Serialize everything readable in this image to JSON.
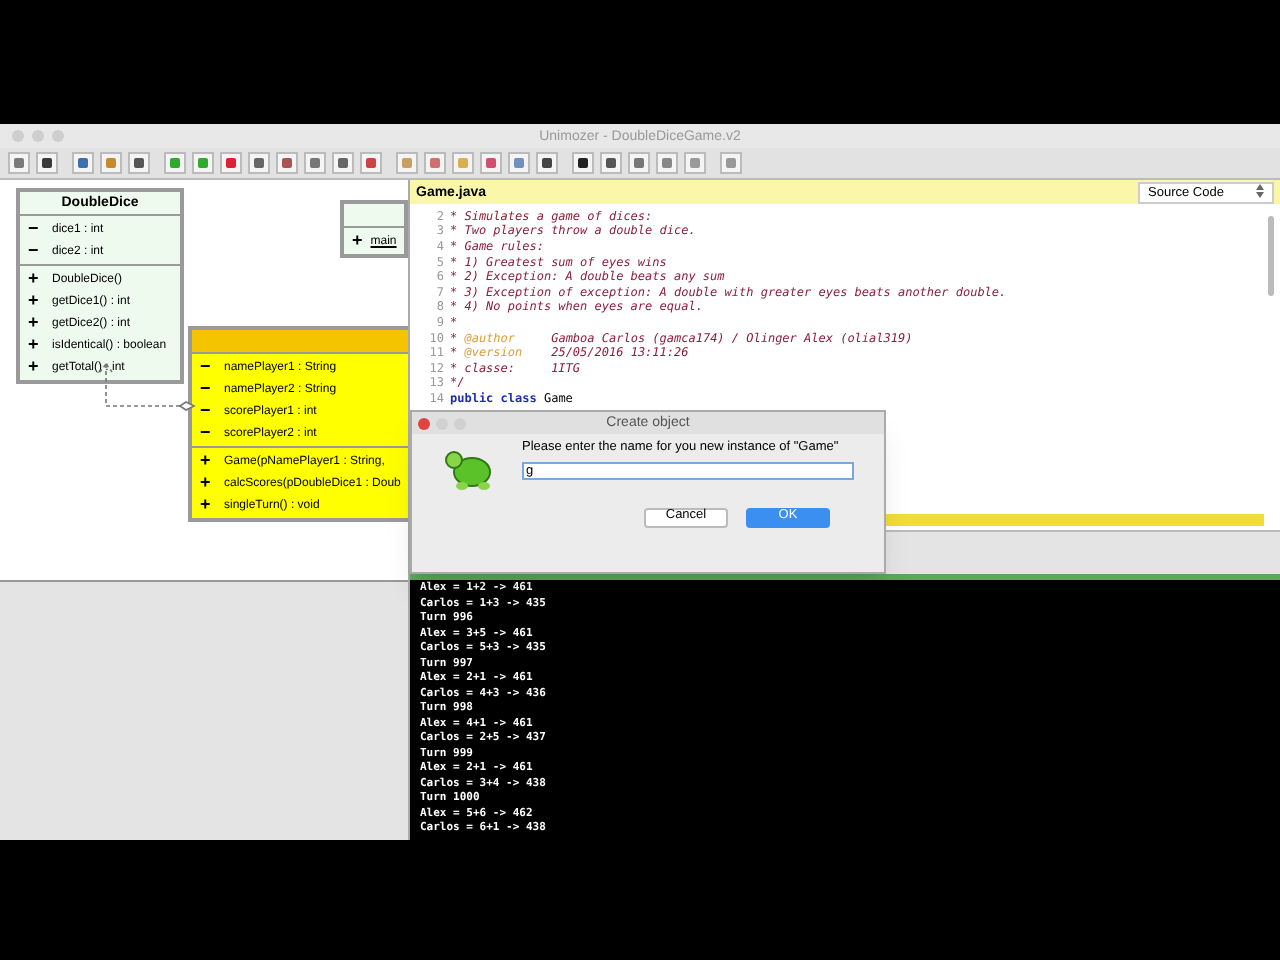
{
  "window": {
    "title": "Unimozer - DoubleDiceGame.v2"
  },
  "diagram": {
    "classes": [
      {
        "name": "DoubleDice",
        "selected": false,
        "members": [
          {
            "sign": "−",
            "text": "dice1 : int",
            "kind": "field"
          },
          {
            "sign": "−",
            "text": "dice2 : int",
            "kind": "field"
          },
          {
            "sign": "+",
            "text": "DoubleDice()",
            "kind": "method"
          },
          {
            "sign": "+",
            "text": "getDice1() : int",
            "kind": "method"
          },
          {
            "sign": "+",
            "text": "getDice2() : int",
            "kind": "method"
          },
          {
            "sign": "+",
            "text": "isIdentical() : boolean",
            "kind": "method"
          },
          {
            "sign": "+",
            "text": "getTotal() : int",
            "kind": "method"
          }
        ]
      },
      {
        "selected": false,
        "members": [
          {
            "sign": "+",
            "text": "main",
            "kind": "static"
          }
        ]
      },
      {
        "selected": true,
        "members": [
          {
            "sign": "−",
            "text": "namePlayer1 : String",
            "kind": "field"
          },
          {
            "sign": "−",
            "text": "namePlayer2 : String",
            "kind": "field"
          },
          {
            "sign": "−",
            "text": "scorePlayer1 : int",
            "kind": "field"
          },
          {
            "sign": "−",
            "text": "scorePlayer2 : int",
            "kind": "field"
          },
          {
            "sign": "+",
            "text": "Game(pNamePlayer1 : String,",
            "kind": "method"
          },
          {
            "sign": "+",
            "text": "calcScores(pDoubleDice1 : Doub",
            "kind": "method"
          },
          {
            "sign": "+",
            "text": "singleTurn() : void",
            "kind": "method"
          }
        ]
      }
    ]
  },
  "editor": {
    "file": "Game.java",
    "view": "Source Code",
    "lines": [
      {
        "number": "2",
        "segments": [
          {
            "kind": "comment",
            "text": "* Simulates a game of dices:"
          }
        ]
      },
      {
        "number": "3",
        "segments": [
          {
            "kind": "comment",
            "text": "* Two players throw a double dice."
          }
        ]
      },
      {
        "number": "4",
        "segments": [
          {
            "kind": "comment",
            "text": "* Game rules:"
          }
        ]
      },
      {
        "number": "5",
        "segments": [
          {
            "kind": "comment",
            "text": "* 1) Greatest sum of eyes wins"
          }
        ]
      },
      {
        "number": "6",
        "segments": [
          {
            "kind": "comment",
            "text": "* 2) Exception: A double beats any sum"
          }
        ]
      },
      {
        "number": "7",
        "segments": [
          {
            "kind": "comment",
            "text": "* 3) Exception of exception: A double with greater eyes beats another double."
          }
        ]
      },
      {
        "number": "8",
        "segments": [
          {
            "kind": "comment",
            "text": "* 4) No points when eyes are equal."
          }
        ]
      },
      {
        "number": "9",
        "segments": [
          {
            "kind": "comment",
            "text": "*"
          }
        ]
      },
      {
        "number": "10",
        "segments": [
          {
            "kind": "comment",
            "text": "* "
          },
          {
            "kind": "tag",
            "text": "@author"
          },
          {
            "kind": "comment",
            "text": "     Gamboa Carlos (gamca174) / Olinger Alex (olial319)"
          }
        ]
      },
      {
        "number": "11",
        "segments": [
          {
            "kind": "comment",
            "text": "* "
          },
          {
            "kind": "tag",
            "text": "@version"
          },
          {
            "kind": "comment",
            "text": "    25/05/2016 13:11:26"
          }
        ]
      },
      {
        "number": "12",
        "segments": [
          {
            "kind": "comment",
            "text": "* classe:     1ITG"
          }
        ]
      },
      {
        "number": "13",
        "segments": [
          {
            "kind": "comment",
            "text": "*/"
          }
        ]
      },
      {
        "number": "14",
        "segments": [
          {
            "kind": "keyword",
            "text": "public class"
          },
          {
            "kind": "plain",
            "text": " Game"
          }
        ]
      }
    ]
  },
  "dialog": {
    "title": "Create object",
    "message": "Please enter the name for you new instance of \"Game\"",
    "value": "g",
    "buttons": [
      {
        "label": "Cancel",
        "default": false
      },
      {
        "label": "OK",
        "default": true
      }
    ]
  },
  "console": [
    "Alex = 1+2 -> 461",
    "Carlos = 1+3 -> 435",
    "Turn 996",
    "Alex = 3+5 -> 461",
    "Carlos = 5+3 -> 435",
    "Turn 997",
    "Alex = 2+1 -> 461",
    "Carlos = 4+3 -> 436",
    "Turn 998",
    "Alex = 4+1 -> 461",
    "Carlos = 2+5 -> 437",
    "Turn 999",
    "Alex = 2+1 -> 461",
    "Carlos = 3+4 -> 438",
    "Turn 1000",
    "Alex = 5+6 -> 462",
    "Carlos = 6+1 -> 438"
  ]
}
